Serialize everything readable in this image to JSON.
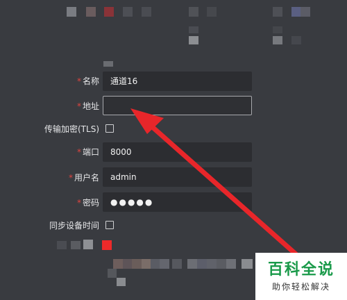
{
  "form": {
    "name": {
      "label": "名称",
      "value": "通道16"
    },
    "address": {
      "label": "地址",
      "value": ""
    },
    "tls": {
      "label": "传输加密(TLS)",
      "checked": false
    },
    "port": {
      "label": "端口",
      "value": "8000"
    },
    "username": {
      "label": "用户名",
      "value": "admin"
    },
    "password": {
      "label": "密码",
      "value": "●●●●●"
    },
    "sync_time": {
      "label": "同步设备时间",
      "checked": false
    },
    "required_mark": "*"
  },
  "watermark": {
    "title": "百科全说",
    "subtitle": "助你轻松解决"
  },
  "colors": {
    "arrow": "#e8262a",
    "required": "#e0443f",
    "watermark_green": "#1a9a4a"
  }
}
